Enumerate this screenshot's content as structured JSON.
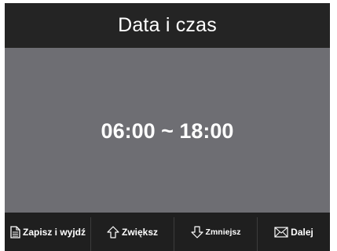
{
  "header": {
    "title": "Data i czas"
  },
  "main": {
    "time_range": "06:00 ~ 18:00"
  },
  "footer": {
    "buttons": [
      {
        "label": "Zapisz i wyjdź",
        "icon": "document-icon"
      },
      {
        "label": "Zwiększ",
        "icon": "arrow-up-icon"
      },
      {
        "label": "Zmniejsz",
        "icon": "arrow-down-icon"
      },
      {
        "label": "Dalej",
        "icon": "envelope-icon"
      }
    ]
  },
  "colors": {
    "header_bg": "#242424",
    "panel_bg": "#6e6e73",
    "footer_bg": "#1f1f1f",
    "text": "#ffffff"
  }
}
